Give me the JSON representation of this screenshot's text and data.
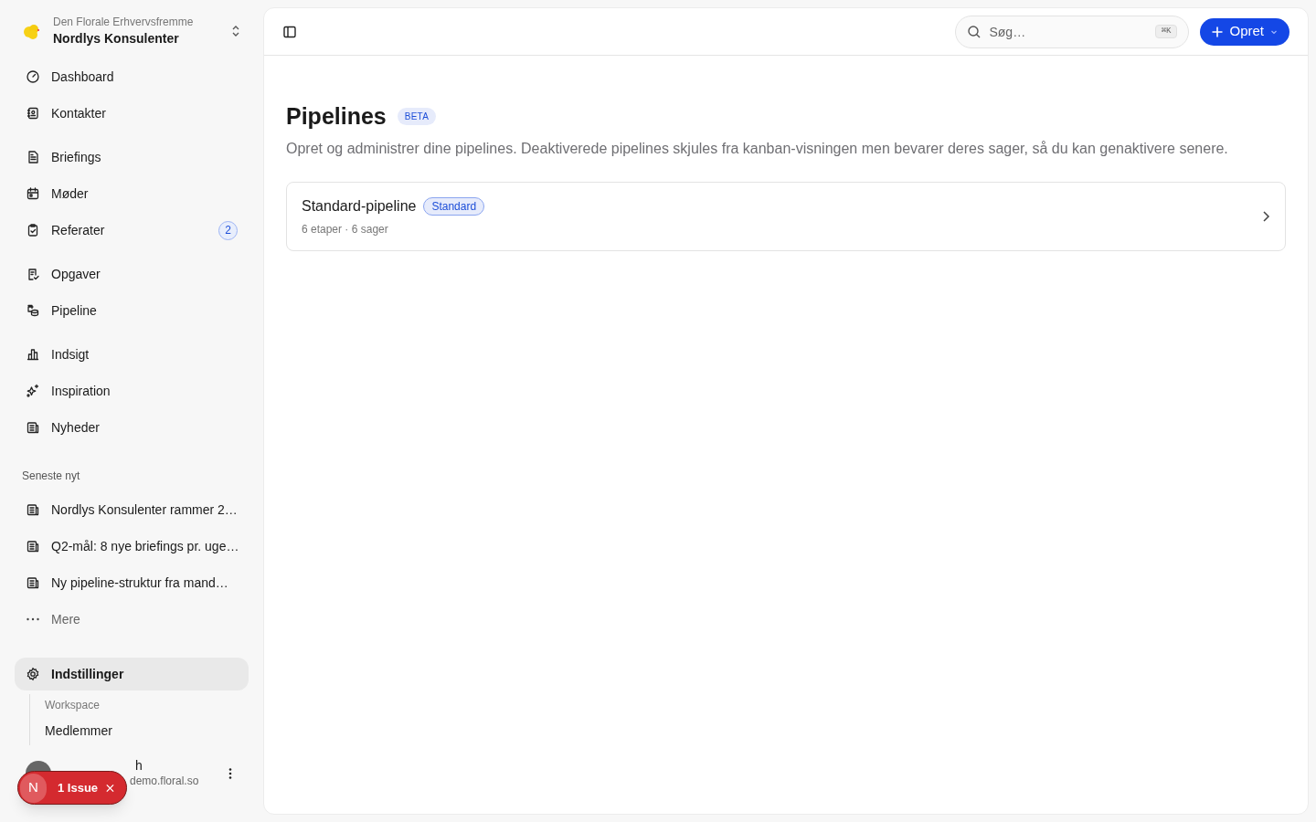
{
  "workspace": {
    "org": "Den Florale Erhvervsfremme",
    "name": "Nordlys Konsulenter"
  },
  "nav_groups": [
    [
      {
        "label": "Dashboard"
      },
      {
        "label": "Kontakter"
      }
    ],
    [
      {
        "label": "Briefings"
      },
      {
        "label": "Møder"
      },
      {
        "label": "Referater",
        "badge": "2"
      }
    ],
    [
      {
        "label": "Opgaver"
      },
      {
        "label": "Pipeline"
      }
    ],
    [
      {
        "label": "Indsigt"
      },
      {
        "label": "Inspiration"
      },
      {
        "label": "Nyheder"
      }
    ]
  ],
  "recent_news": {
    "title": "Seneste nyt",
    "items": [
      "Nordlys Konsulenter rammer 2…",
      "Q2-mål: 8 nye briefings pr. uge…",
      "Ny pipeline-struktur fra mand…"
    ],
    "more": "Mere"
  },
  "settings": {
    "label": "Indstillinger",
    "selected": true,
    "section": "Workspace",
    "children": [
      {
        "label": "Medlemmer"
      }
    ]
  },
  "user": {
    "name": "h",
    "email": "demo.floral.so"
  },
  "issue_badge": {
    "letter": "N",
    "label": "1 Issue"
  },
  "topbar": {
    "search_placeholder": "Søg…",
    "shortcut": "⌘K",
    "create_button": "Opret"
  },
  "page": {
    "title": "Pipelines",
    "title_badge": "BETA",
    "description": "Opret og administrer dine pipelines. Deaktiverede pipelines skjules fra kanban-visningen men bevarer deres sager, så du kan genaktivere senere."
  },
  "pipelines": [
    {
      "name": "Standard-pipeline",
      "tag": "Standard",
      "meta": "6 etaper · 6 sager"
    }
  ]
}
